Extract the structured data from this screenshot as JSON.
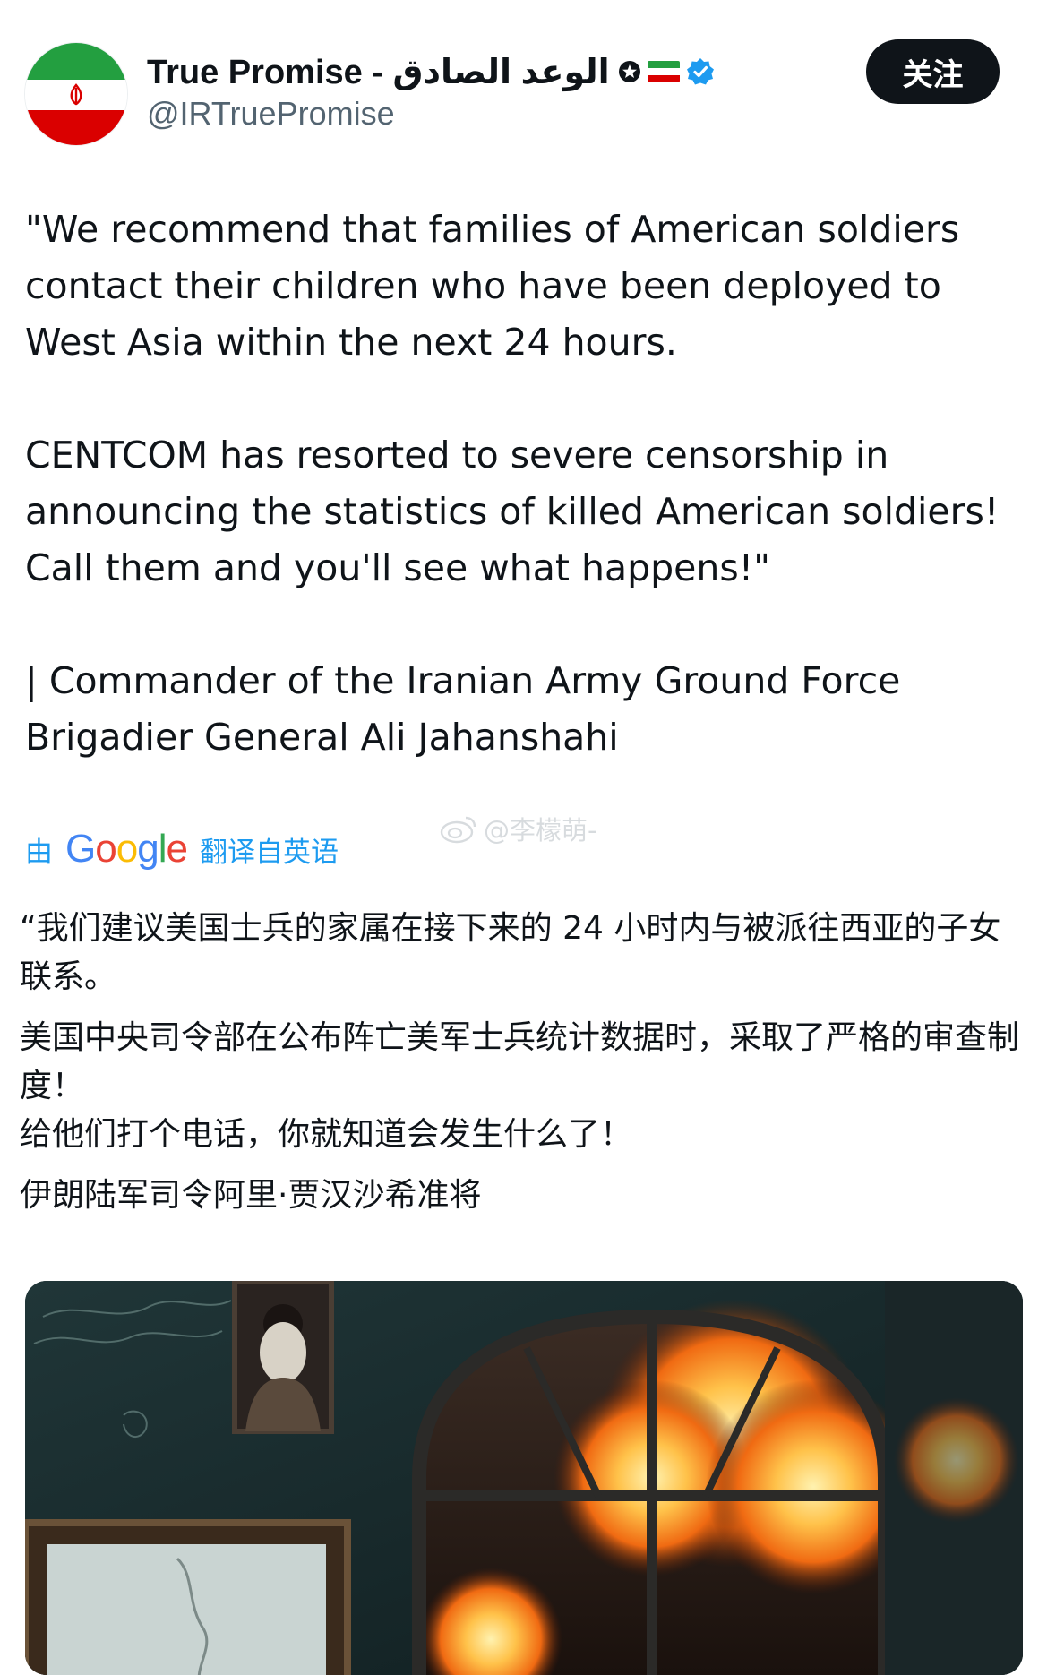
{
  "author": {
    "display_name": "True Promise - الوعد الصادق",
    "handle": "@IRTruePromise",
    "avatar_icon": "iran-flag-avatar",
    "name_icons": [
      "star-badge-icon",
      "iran-flag-icon",
      "verified-badge-icon"
    ]
  },
  "follow_button": {
    "label": "关注"
  },
  "tweet": {
    "paragraphs": [
      "\"We recommend that families of American soldiers contact their children who have been deployed to West Asia within the next 24 hours.",
      "CENTCOM has resorted to severe censorship in announcing the statistics of killed American soldiers! Call them and you'll see what happens!\"",
      "| Commander of the Iranian Army Ground Force Brigadier General Ali Jahanshahi"
    ]
  },
  "translation": {
    "by_label": "由",
    "brand": "Google",
    "from_label": "翻译自英语",
    "lines": [
      "“我们建议美国士兵的家属在接下来的 24 小时内与被派往西亚的子女联系。",
      "美国中央司令部在公布阵亡美军士兵统计数据时，采取了严格的审查制度！",
      "给他们打个电话，你就知道会发生什么了！",
      "伊朗陆军司令阿里·贾汉沙希准将"
    ]
  },
  "watermark": {
    "text": "@李檬萌-"
  },
  "media": {
    "icon": "war-room-explosion-image",
    "colors": {
      "wall": "#1b2b2e",
      "fire": "#ff8a1c",
      "fire_core": "#ffd36b",
      "smoke": "#3a2a22"
    }
  },
  "colors": {
    "text": "#0f1419",
    "secondary": "#536471",
    "link_blue": "#1d9bf0",
    "verified_blue": "#1d9bf0",
    "button_bg": "#0f1419"
  }
}
